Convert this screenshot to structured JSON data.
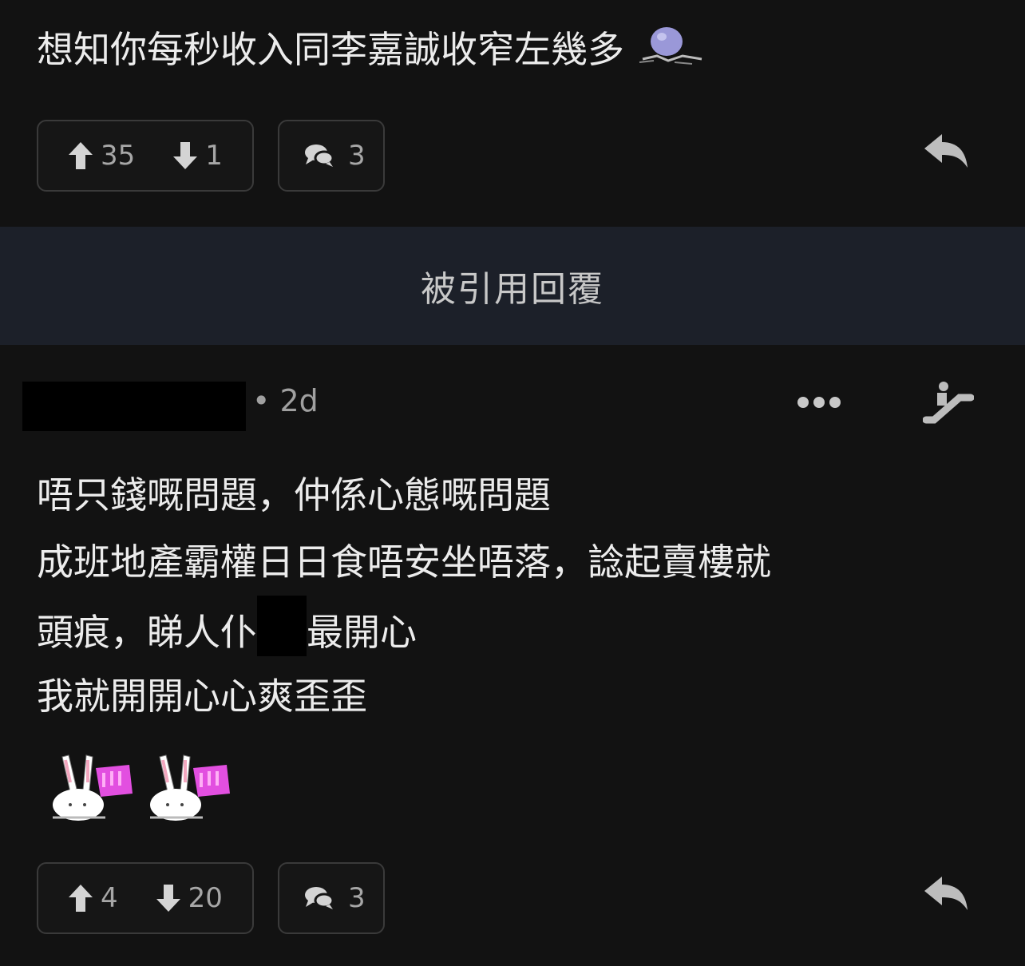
{
  "top_post": {
    "text": "想知你每秒收入同李嘉誠收窄左幾多",
    "upvotes": "35",
    "downvotes": "1",
    "comments": "3"
  },
  "quote_section": {
    "label": "被引用回覆"
  },
  "reply_post": {
    "age": "• 2d",
    "lines": [
      "唔只錢嘅問題，仲係心態嘅問題",
      "成班地產霸權日日食唔安坐唔落，諗起賣樓就",
      "頭痕，睇人仆",
      "最開心",
      "我就開開心心爽歪歪"
    ],
    "upvotes": "4",
    "downvotes": "20",
    "comments": "3"
  },
  "icons": {
    "upvote": "arrow-up-icon",
    "downvote": "arrow-down-icon",
    "comments": "chat-bubbles-icon",
    "reply": "reply-icon",
    "more": "more-dots-icon",
    "escalate": "escalator-icon",
    "emoji": "rabbit-rock-hand-sticker",
    "inline_emoji": "ghost-sticker"
  },
  "colors": {
    "background": "#121212",
    "quote_band": "#1c2029",
    "pill_border": "#3a3a3a",
    "muted_text": "#a7a7a7"
  }
}
